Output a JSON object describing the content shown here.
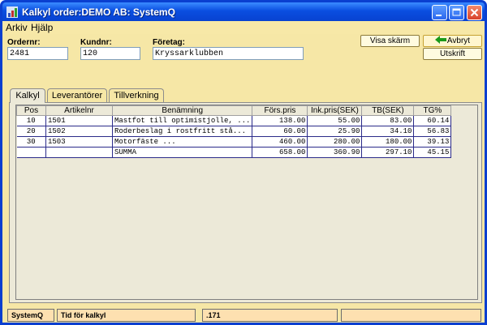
{
  "window": {
    "title": "Kalkyl order:DEMO AB: SystemQ"
  },
  "menu": [
    {
      "label": "Arkiv"
    },
    {
      "label": "Hjälp"
    }
  ],
  "header": {
    "ordernr_label": "Ordernr:",
    "ordernr_value": "2481",
    "kundnr_label": "Kundnr:",
    "kundnr_value": "120",
    "foretag_label": "Företag:",
    "foretag_value": "Kryssarklubben"
  },
  "buttons": {
    "visa": "Visa skärm",
    "avbryt": "Avbryt",
    "utskrift": "Utskrift"
  },
  "tabs": [
    {
      "label": "Kalkyl"
    },
    {
      "label": "Leverantörer"
    },
    {
      "label": "Tillverkning"
    }
  ],
  "table": {
    "columns": [
      "Pos",
      "Artikelnr",
      "Benämning",
      "Förs.pris",
      "Ink.pris(SEK)",
      "TB(SEK)",
      "TG%"
    ],
    "rows": [
      {
        "pos": "10",
        "artikelnr": "1501",
        "benamning": "Mastfot till optimistjolle, ...",
        "fors": "138.00",
        "ink": "55.00",
        "tb": "83.00",
        "tg": "60.14"
      },
      {
        "pos": "20",
        "artikelnr": "1502",
        "benamning": "Roderbeslag  i rostfritt stå...",
        "fors": "60.00",
        "ink": "25.90",
        "tb": "34.10",
        "tg": "56.83"
      },
      {
        "pos": "30",
        "artikelnr": "1503",
        "benamning": "Motorfäste                 ...",
        "fors": "460.00",
        "ink": "280.00",
        "tb": "180.00",
        "tg": "39.13"
      }
    ],
    "summary": {
      "label": "SUMMA",
      "fors": "658.00",
      "ink": "360.90",
      "tb": "297.10",
      "tg": "45.15"
    }
  },
  "status": {
    "app": "SystemQ",
    "label": "Tid för kalkyl",
    "value": ".171",
    "extra": ""
  }
}
